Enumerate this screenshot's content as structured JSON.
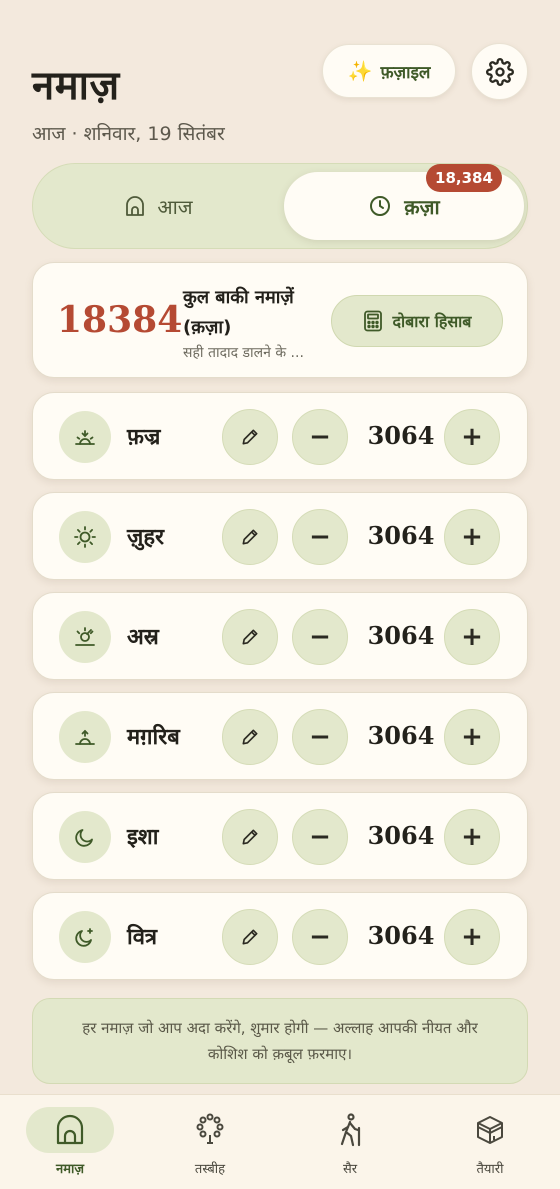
{
  "header": {
    "title": "नमाज़",
    "date": "आज · शनिवार, 19 सितंबर",
    "fazail_label": "फ़ज़ाइल",
    "fazail_icon": "sparkles-icon",
    "settings_icon": "gear-icon"
  },
  "tabs": {
    "today_label": "आज",
    "today_icon": "mosque-icon",
    "qaza_label": "क़ज़ा",
    "qaza_icon": "clock-icon",
    "qaza_badge": "18,384"
  },
  "summary": {
    "total": "18384",
    "title": "कुल बाकी नमाज़ें (क़ज़ा)",
    "note": "सही तादाद डालने के ...",
    "recalc_label": "दोबारा हिसाब",
    "recalc_icon": "calculator-icon"
  },
  "prayers": [
    {
      "name": "फ़ज्र",
      "count": "3064",
      "icon": "sunrise-icon"
    },
    {
      "name": "ज़ुहर",
      "count": "3064",
      "icon": "sun-icon"
    },
    {
      "name": "अस्र",
      "count": "3064",
      "icon": "afternoon-sun-icon"
    },
    {
      "name": "मग़रिब",
      "count": "3064",
      "icon": "sunset-icon"
    },
    {
      "name": "इशा",
      "count": "3064",
      "icon": "moon-icon"
    },
    {
      "name": "वित्र",
      "count": "3064",
      "icon": "moon-star-icon"
    }
  ],
  "controls": {
    "minus": "−",
    "plus": "+"
  },
  "quote": "हर नमाज़ जो आप अदा करेंगे, शुमार होगी — अल्लाह आपकी नीयत और कोशिश को क़बूल फ़रमाए।",
  "nav": [
    {
      "label": "नमाज़",
      "icon": "mosque-icon",
      "active": true
    },
    {
      "label": "तस्बीह",
      "icon": "prayer-beads-icon",
      "active": false
    },
    {
      "label": "सैर",
      "icon": "walking-icon",
      "active": false
    },
    {
      "label": "तैयारी",
      "icon": "kaaba-icon",
      "active": false
    }
  ],
  "colors": {
    "background": "#f3e9dd",
    "accent_green": "#3f5a28",
    "soft_green": "#e3e8cc",
    "alert_red": "#b54a33",
    "card": "#fffcf5"
  }
}
